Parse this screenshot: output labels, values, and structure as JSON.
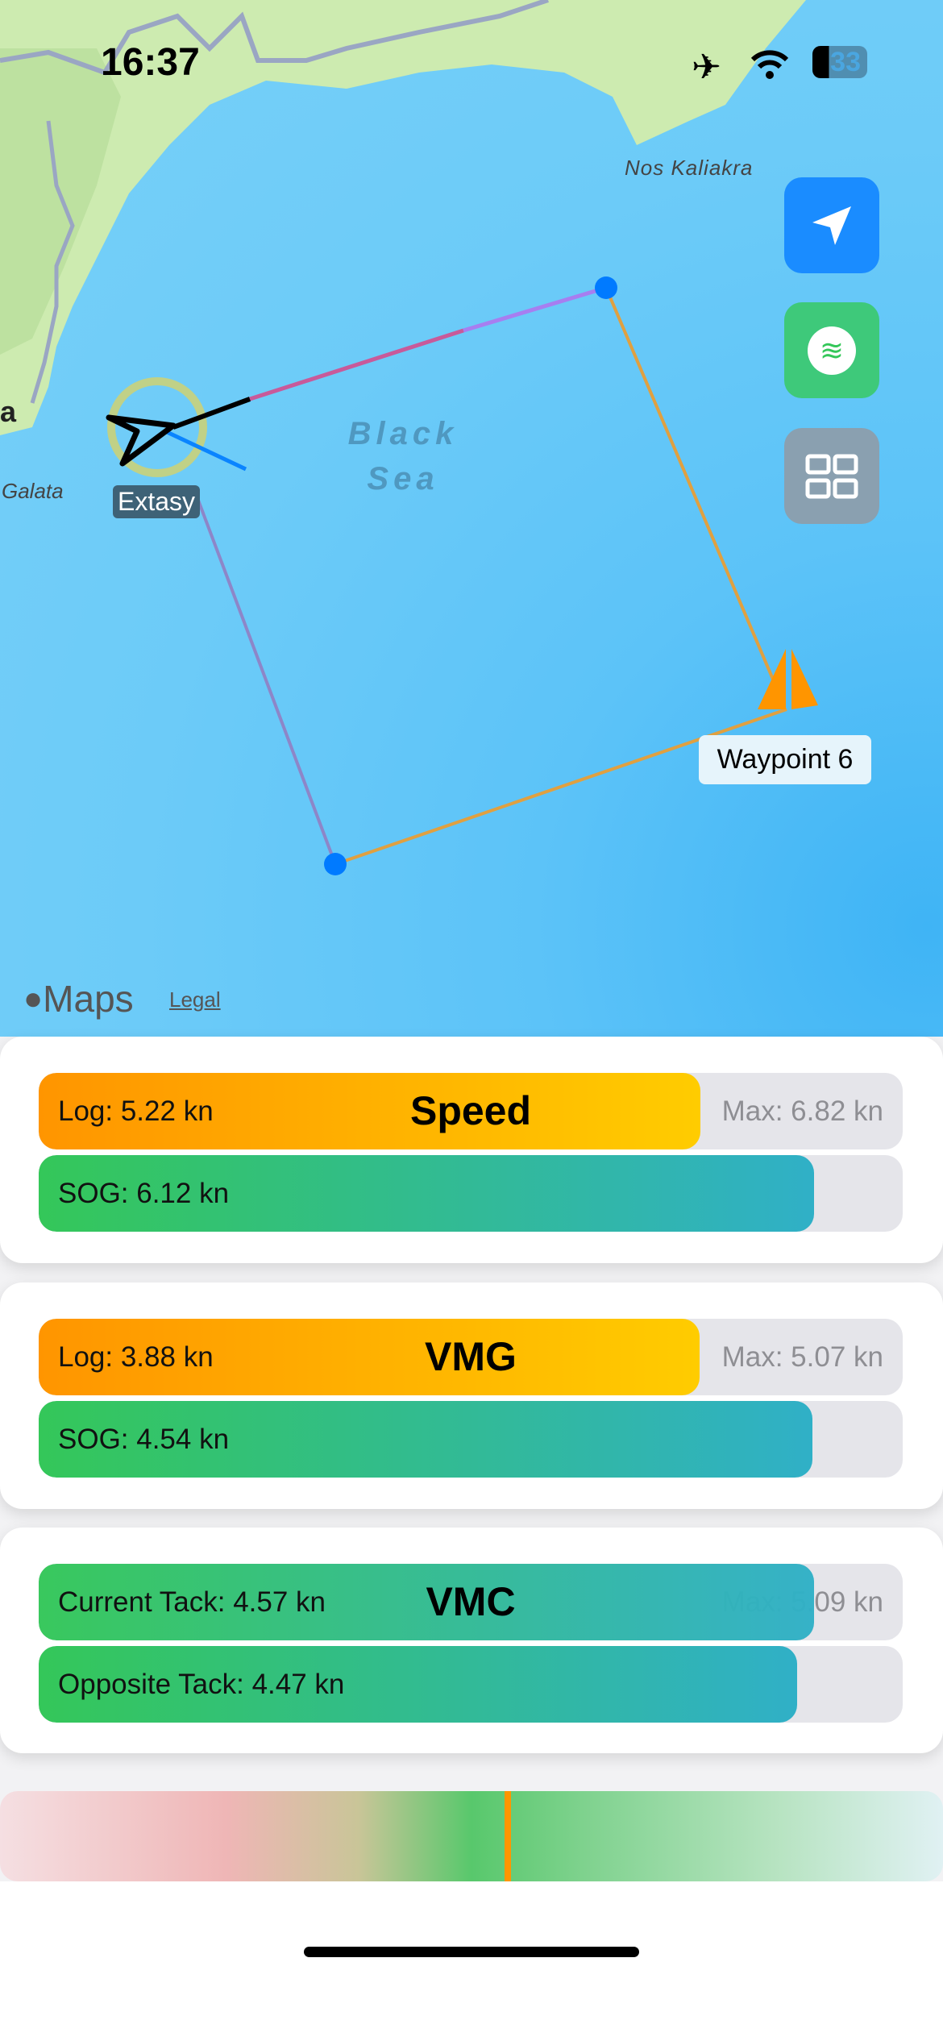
{
  "status": {
    "time": "16:37",
    "battery": "33"
  },
  "map": {
    "labels": {
      "cape": "Nos Kaliakra",
      "sea_line1": "Black",
      "sea_line2": "Sea",
      "town": "Galata",
      "edge": "a"
    },
    "vessel": "Extasy",
    "waypoint": "Waypoint 6",
    "attribution": "Maps",
    "legal": "Legal"
  },
  "buttons": {
    "locate": "location-arrow-icon",
    "wind": "wind-icon",
    "layout": "grid-icon"
  },
  "speed": {
    "title": "Speed",
    "log": "Log: 5.22 kn",
    "max": "Max: 6.82 kn",
    "sog": "SOG: 6.12 kn",
    "log_value": 5.22,
    "sog_value": 6.12,
    "max_value": 6.82
  },
  "vmg": {
    "title": "VMG",
    "log": "Log: 3.88 kn",
    "max": "Max: 5.07 kn",
    "sog": "SOG: 4.54 kn",
    "log_value": 3.88,
    "sog_value": 4.54,
    "max_value": 5.07
  },
  "vmc": {
    "title": "VMC",
    "current": "Current Tack: 4.57 kn",
    "max": "Max: 5.09 kn",
    "opposite": "Opposite Tack: 4.47 kn",
    "current_value": 4.57,
    "opposite_value": 4.47,
    "max_value": 5.09
  },
  "gauge": {
    "position_fraction": 0.535
  },
  "colors": {
    "accent_orange": "#ff9500",
    "accent_green": "#34c759",
    "route_orange": "#e0a040",
    "waypoint_blue": "#007aff"
  }
}
